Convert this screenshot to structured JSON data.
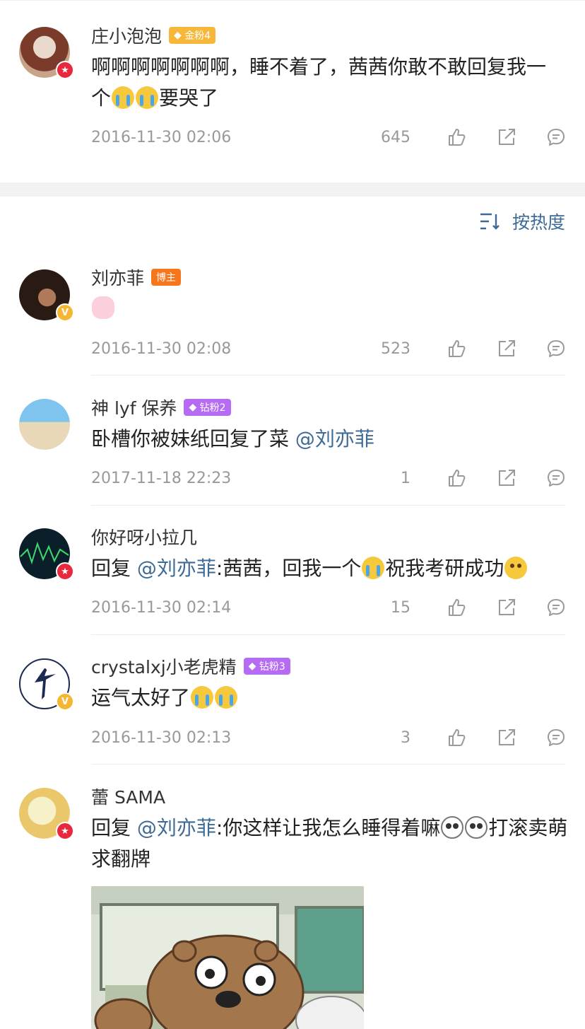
{
  "post": {
    "name": "庄小泡泡",
    "tag": "金粉4",
    "text_before": "啊啊啊啊啊啊啊，睡不着了，茜茜你敢不敢回复我一个",
    "text_after": "要哭了",
    "date": "2016-11-30 02:06",
    "likes": "645"
  },
  "sort": {
    "label": "按热度"
  },
  "comments": [
    {
      "name": "刘亦菲",
      "tag": "博主",
      "date": "2016-11-30 02:08",
      "likes": "523"
    },
    {
      "name": "神 lyf 保养",
      "tag": "钻粉2",
      "text": "卧槽你被妹纸回复了菜 ",
      "mention": "@刘亦菲",
      "date": "2017-11-18 22:23",
      "likes": "1"
    },
    {
      "name": "你好呀小拉几",
      "reply_prefix": "回复 ",
      "mention": "@刘亦菲",
      "text_a": ":茜茜，回我一个",
      "text_b": "祝我考研成功",
      "date": "2016-11-30 02:14",
      "likes": "15"
    },
    {
      "name": "crystalxj小老虎精",
      "tag": "钻粉3",
      "text": "运气太好了",
      "date": "2016-11-30 02:13",
      "likes": "3"
    },
    {
      "name": "蕾 SAMA",
      "reply_prefix": "回复 ",
      "mention": "@刘亦菲",
      "text_a": ":你这样让我怎么睡得着嘛",
      "text_b": "打滚卖萌求翻牌"
    }
  ],
  "colors": {
    "link": "#3d6a96",
    "gold_tag": "#f7b83a",
    "host_tag": "#f7761c",
    "diamond_tag": "#b56cf3",
    "vip_badge": "#e8283c",
    "verified_badge": "#f5b731"
  },
  "icons": [
    "like-icon",
    "share-icon",
    "reply-icon",
    "sort-icon",
    "diamond-icon"
  ]
}
